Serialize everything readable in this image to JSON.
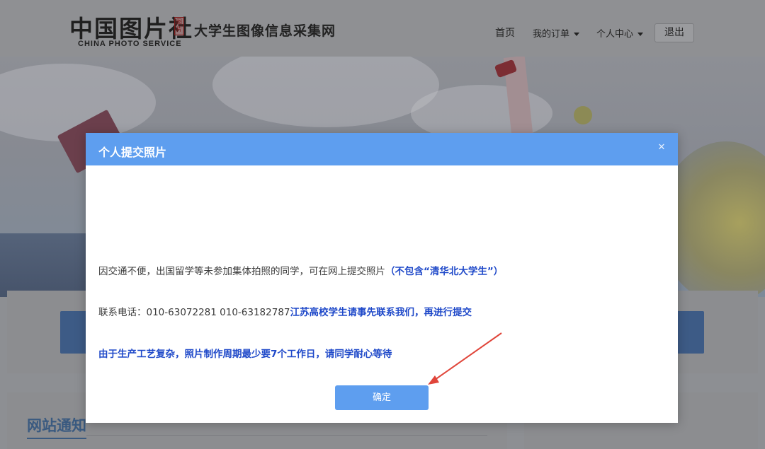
{
  "header": {
    "logo_main": "中国图片社",
    "logo_seal": "图片",
    "logo_sub": "CHINA PHOTO SERVICE",
    "tagline": "大学生图像信息采集网",
    "nav": {
      "home": "首页",
      "orders": "我的订单",
      "account": "个人中心",
      "logout": "退出"
    }
  },
  "page": {
    "notice_title": "网站通知"
  },
  "modal": {
    "title": "个人提交照片",
    "close_icon": "close-icon",
    "line1_text": "因交通不便，出国留学等未参加集体拍照的同学，可在网上提交照片",
    "line1_emph": "（不包含“清华北大学生”）",
    "line2_text": "联系电话：010-63072281 010-63182787",
    "line2_emph": "江苏高校学生请事先联系我们，再进行提交",
    "line3_emph": "由于生产工艺复杂，照片制作周期最少要7个工作日，请同学耐心等待",
    "confirm": "确定"
  },
  "colors": {
    "modal_header": "#5e9eef",
    "emphasis_text": "#1f49c9",
    "annotation_arrow": "#e0453a"
  }
}
